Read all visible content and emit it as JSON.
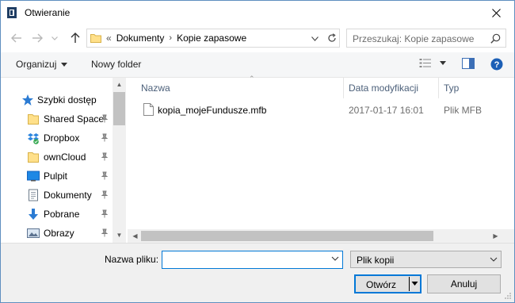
{
  "window": {
    "title": "Otwieranie"
  },
  "address": {
    "overflow": "«",
    "crumbs": [
      "Dokumenty",
      "Kopie zapasowe"
    ]
  },
  "search": {
    "placeholder": "Przeszukaj: Kopie zapasowe"
  },
  "toolbar": {
    "organize": "Organizuj",
    "new_folder": "Nowy folder"
  },
  "nav": {
    "quick_access": "Szybki dostęp",
    "items": [
      {
        "label": "Shared Space",
        "icon": "folder-icon"
      },
      {
        "label": "Dropbox",
        "icon": "dropbox-icon"
      },
      {
        "label": "ownCloud",
        "icon": "folder-icon"
      },
      {
        "label": "Pulpit",
        "icon": "desktop-icon"
      },
      {
        "label": "Dokumenty",
        "icon": "documents-icon"
      },
      {
        "label": "Pobrane",
        "icon": "download-icon"
      },
      {
        "label": "Obrazy",
        "icon": "pictures-icon"
      }
    ]
  },
  "columns": {
    "name": "Nazwa",
    "date": "Data modyfikacji",
    "type": "Typ"
  },
  "files": [
    {
      "name": "kopia_mojeFundusze.mfb",
      "date": "2017-01-17 16:01",
      "type": "Plik MFB"
    }
  ],
  "bottom": {
    "filename_label": "Nazwa pliku:",
    "filename_value": "",
    "filetype": "Plik kopii",
    "open": "Otwórz",
    "cancel": "Anuluj"
  },
  "colors": {
    "accent": "#0078d7",
    "header_text": "#4c607a"
  }
}
